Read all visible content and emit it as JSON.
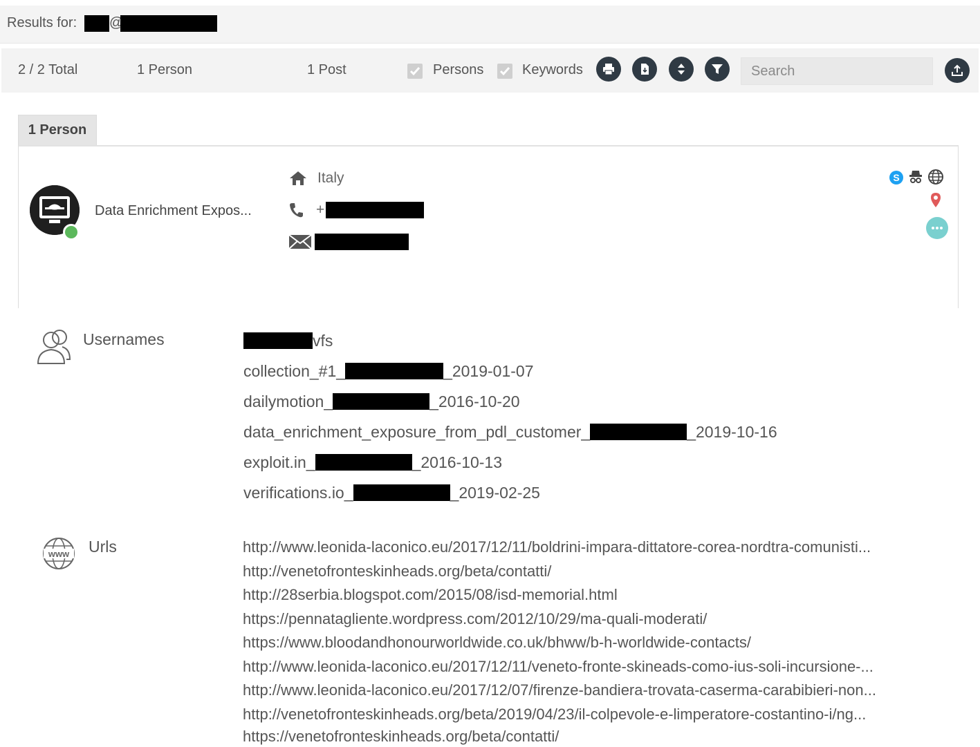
{
  "header": {
    "results_label": "Results for:",
    "at_symbol": "@"
  },
  "toolbar": {
    "total": "2 / 2 Total",
    "persons_count": "1 Person",
    "posts_count": "1 Post",
    "filters": [
      {
        "label": "Persons",
        "checked": true
      },
      {
        "label": "Keywords",
        "checked": true
      }
    ],
    "action_icons": [
      "print-icon",
      "export-file-icon",
      "sort-icon",
      "filter-icon"
    ],
    "search_placeholder": "Search",
    "upload_icon": "upload-icon"
  },
  "tab": {
    "label": "1 Person"
  },
  "person": {
    "name": "Data Enrichment Expos...",
    "country": "Italy",
    "phone_prefix": "+",
    "status_color": "#5cb85c",
    "source_icons": [
      "skype-icon",
      "incognito-icon",
      "globe-icon",
      "location-pin-icon"
    ]
  },
  "usernames": {
    "title": "Usernames",
    "items": [
      {
        "prefix": "",
        "suffix": "vfs"
      },
      {
        "prefix": "collection_#1_",
        "suffix": "_2019-01-07"
      },
      {
        "prefix": "dailymotion_",
        "suffix": "_2016-10-20"
      },
      {
        "prefix": "data_enrichment_exposure_from_pdl_customer_",
        "suffix": "_2019-10-16"
      },
      {
        "prefix": "exploit.in_",
        "suffix": "_2016-10-13"
      },
      {
        "prefix": "verifications.io_",
        "suffix": "_2019-02-25"
      }
    ]
  },
  "urls": {
    "title": "Urls",
    "items": [
      "http://www.leonida-laconico.eu/2017/12/11/boldrini-impara-dittatore-corea-nordtra-comunisti...",
      "http://venetofronteskinheads.org/beta/contatti/",
      "http://28serbia.blogspot.com/2015/08/isd-memorial.html",
      "https://pennatagliente.wordpress.com/2012/10/29/ma-quali-moderati/",
      "https://www.bloodandhonourworldwide.co.uk/bhww/b-h-worldwide-contacts/",
      "http://www.leonida-laconico.eu/2017/12/11/veneto-fronte-skineads-como-ius-soli-incursione-...",
      "http://www.leonida-laconico.eu/2017/12/07/firenze-bandiera-trovata-caserma-carabibieri-non...",
      "http://venetofronteskinheads.org/beta/2019/04/23/il-colpevole-e-limperatore-costantino-i/ng...",
      "https://venetofronteskinheads.org/beta/contatti/"
    ]
  }
}
